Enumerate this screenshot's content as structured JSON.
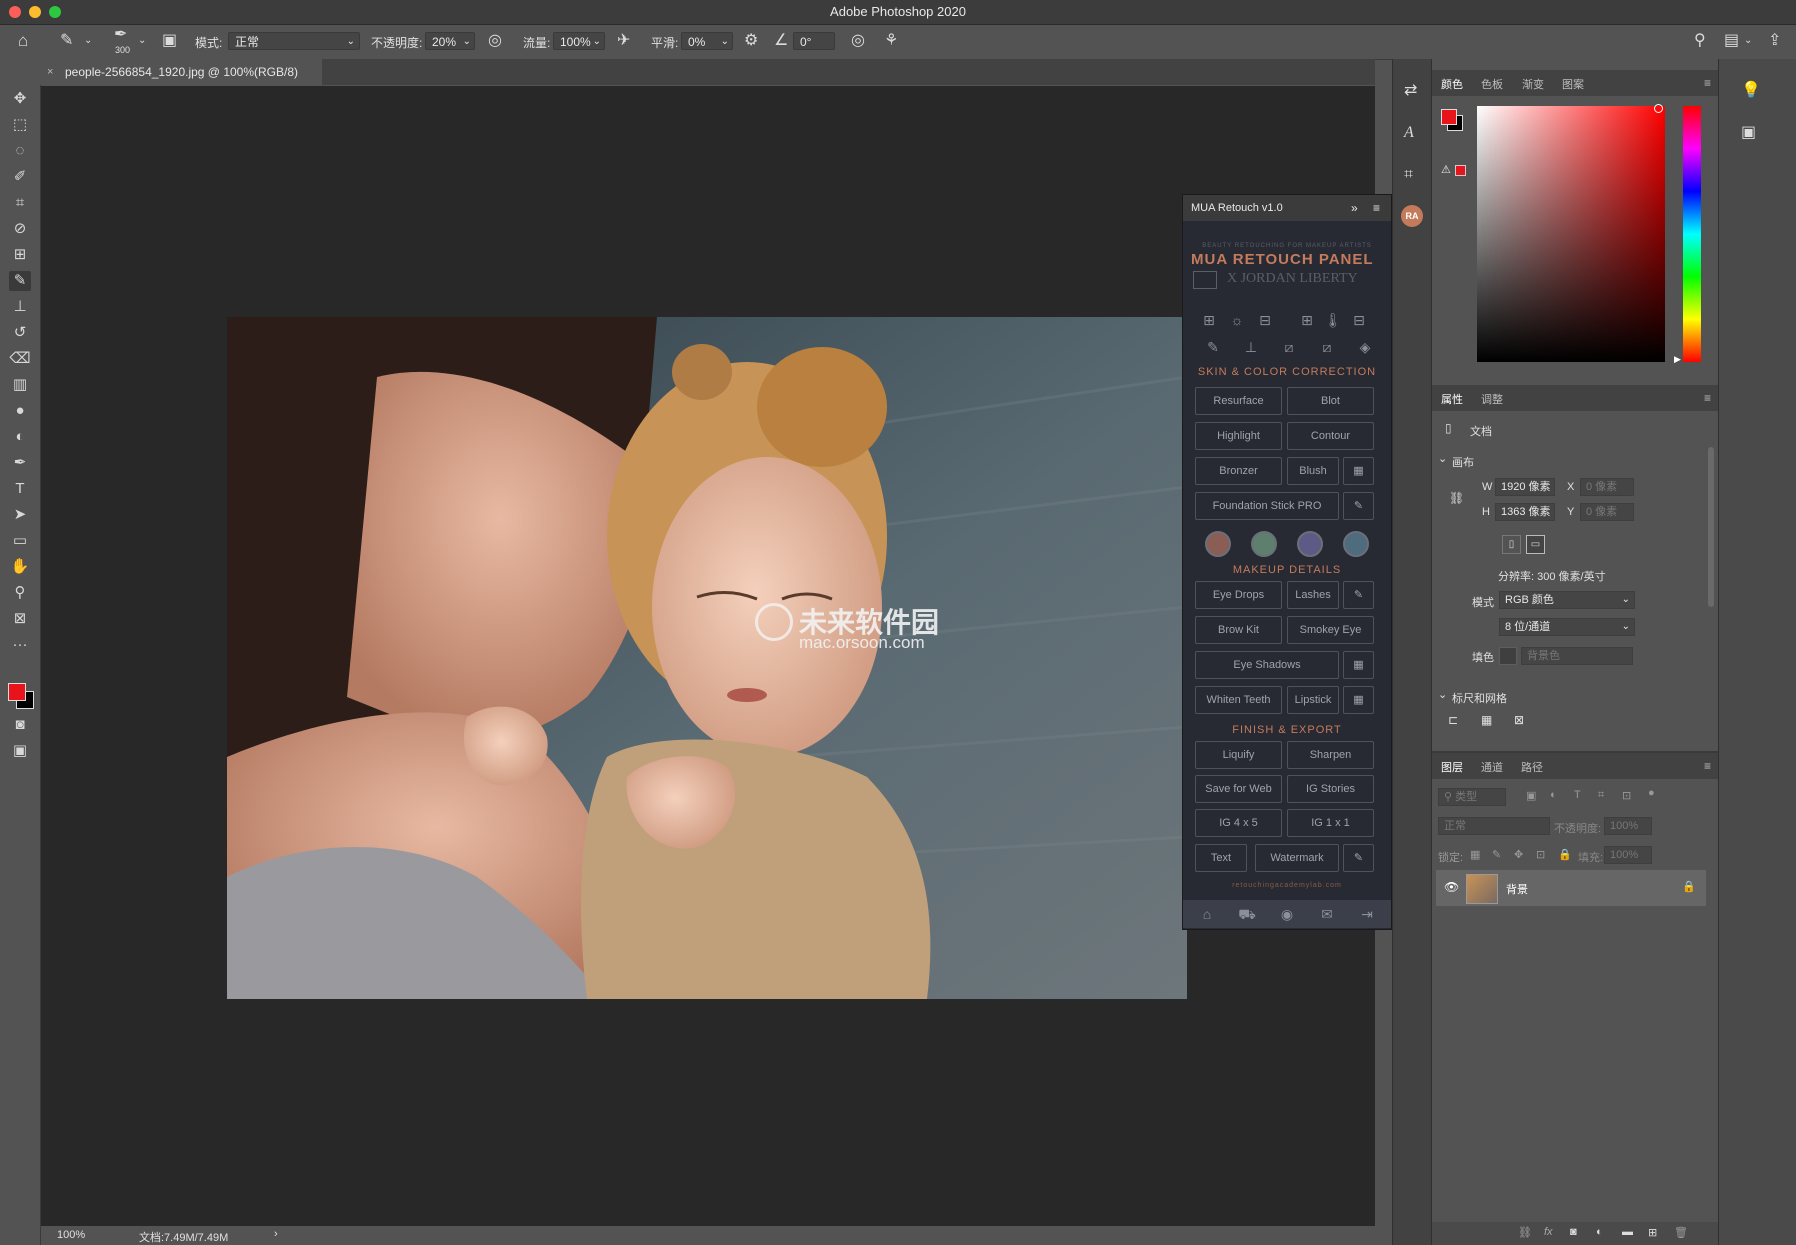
{
  "app": {
    "title": "Adobe Photoshop 2020"
  },
  "colors": {
    "foreground": "#e8141b",
    "background": "#000000",
    "accent": "#c47b5c"
  },
  "options": {
    "brush_size": "300",
    "mode_label": "模式:",
    "mode_value": "正常",
    "opacity_label": "不透明度:",
    "opacity_value": "20%",
    "flow_label": "流量:",
    "flow_value": "100%",
    "smooth_label": "平滑:",
    "smooth_value": "0%",
    "angle_value": "0°"
  },
  "document": {
    "tab_title": "people-2566854_1920.jpg @ 100%(RGB/8)"
  },
  "status": {
    "zoom": "100%",
    "doc_size": "文档:7.49M/7.49M"
  },
  "watermark": {
    "cn": "未来软件园",
    "url": "mac.orsoon.com"
  },
  "mua": {
    "title": "MUA Retouch v1.0",
    "tagline": "BEAUTY RETOUCHING FOR MAKEUP ARTISTS",
    "brand": "MUA RETOUCH PANEL",
    "brand_sub": "X JORDAN LIBERTY",
    "sections": {
      "skin": "SKIN & COLOR CORRECTION",
      "makeup": "MAKEUP DETAILS",
      "finish": "FINISH & EXPORT"
    },
    "buttons": {
      "resurface": "Resurface",
      "blot": "Blot",
      "highlight": "Highlight",
      "contour": "Contour",
      "bronzer": "Bronzer",
      "blush": "Blush",
      "foundation": "Foundation Stick PRO",
      "eye_drops": "Eye Drops",
      "lashes": "Lashes",
      "brow_kit": "Brow Kit",
      "smokey_eye": "Smokey Eye",
      "eye_shadows": "Eye Shadows",
      "whiten_teeth": "Whiten Teeth",
      "lipstick": "Lipstick",
      "liquify": "Liquify",
      "sharpen": "Sharpen",
      "save_web": "Save for Web",
      "ig_stories": "IG Stories",
      "ig_4x5": "IG 4 x 5",
      "ig_1x1": "IG 1 x 1",
      "text": "Text",
      "watermark": "Watermark"
    },
    "swatches": [
      "#8a5d55",
      "#5e7f6d",
      "#5d5a86",
      "#4e6c7e"
    ],
    "footer_url": "retouchingacademylab.com"
  },
  "color_panel": {
    "tabs": [
      "颜色",
      "色板",
      "渐变",
      "图案"
    ]
  },
  "properties": {
    "tabs": [
      "属性",
      "调整"
    ],
    "doc_label": "文档",
    "canvas_label": "画布",
    "w_label": "W",
    "w_value": "1920 像素",
    "h_label": "H",
    "h_value": "1363 像素",
    "x_label": "X",
    "x_value": "0 像素",
    "y_label": "Y",
    "y_value": "0 像素",
    "resolution": "分辨率: 300 像素/英寸",
    "mode_label": "模式",
    "mode_value": "RGB 颜色",
    "depth_value": "8 位/通道",
    "fill_label": "填色",
    "fill_value": "背景色",
    "rulers_label": "标尺和网格"
  },
  "layers": {
    "tabs": [
      "图层",
      "通道",
      "路径"
    ],
    "filter_kind": "类型",
    "blend_mode": "正常",
    "opacity_label": "不透明度:",
    "opacity_value": "100%",
    "lock_label": "锁定:",
    "fill_label": "填充:",
    "fill_value": "100%",
    "layer_name": "背景"
  }
}
